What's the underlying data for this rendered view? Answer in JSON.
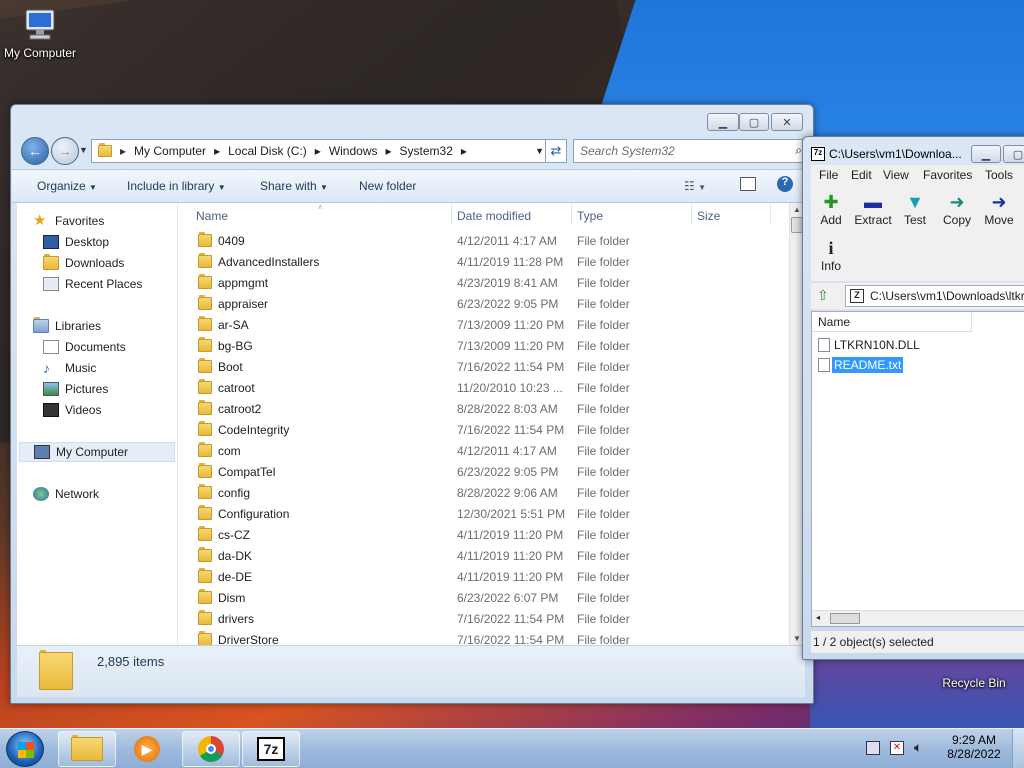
{
  "desktop": {
    "icons": [
      {
        "label": "My Computer"
      },
      {
        "label": "Recycle Bin"
      }
    ]
  },
  "explorer": {
    "breadcrumb": [
      "My Computer",
      "Local Disk (C:)",
      "Windows",
      "System32"
    ],
    "search_placeholder": "Search System32",
    "toolbar": {
      "organize": "Organize",
      "include_in_library": "Include in library",
      "share_with": "Share with",
      "new_folder": "New folder"
    },
    "nav": {
      "favorites": "Favorites",
      "desktop": "Desktop",
      "downloads": "Downloads",
      "recent_places": "Recent Places",
      "libraries": "Libraries",
      "documents": "Documents",
      "music": "Music",
      "pictures": "Pictures",
      "videos": "Videos",
      "my_computer": "My Computer",
      "network": "Network"
    },
    "columns": {
      "name": "Name",
      "date_modified": "Date modified",
      "type": "Type",
      "size": "Size"
    },
    "rows": [
      {
        "name": "0409",
        "date": "4/12/2011 4:17 AM",
        "type": "File folder"
      },
      {
        "name": "AdvancedInstallers",
        "date": "4/11/2019 11:28 PM",
        "type": "File folder"
      },
      {
        "name": "appmgmt",
        "date": "4/23/2019 8:41 AM",
        "type": "File folder"
      },
      {
        "name": "appraiser",
        "date": "6/23/2022 9:05 PM",
        "type": "File folder"
      },
      {
        "name": "ar-SA",
        "date": "7/13/2009 11:20 PM",
        "type": "File folder"
      },
      {
        "name": "bg-BG",
        "date": "7/13/2009 11:20 PM",
        "type": "File folder"
      },
      {
        "name": "Boot",
        "date": "7/16/2022 11:54 PM",
        "type": "File folder"
      },
      {
        "name": "catroot",
        "date": "11/20/2010 10:23 ...",
        "type": "File folder"
      },
      {
        "name": "catroot2",
        "date": "8/28/2022 8:03 AM",
        "type": "File folder"
      },
      {
        "name": "CodeIntegrity",
        "date": "7/16/2022 11:54 PM",
        "type": "File folder"
      },
      {
        "name": "com",
        "date": "4/12/2011 4:17 AM",
        "type": "File folder"
      },
      {
        "name": "CompatTel",
        "date": "6/23/2022 9:05 PM",
        "type": "File folder"
      },
      {
        "name": "config",
        "date": "8/28/2022 9:06 AM",
        "type": "File folder"
      },
      {
        "name": "Configuration",
        "date": "12/30/2021 5:51 PM",
        "type": "File folder"
      },
      {
        "name": "cs-CZ",
        "date": "4/11/2019 11:20 PM",
        "type": "File folder"
      },
      {
        "name": "da-DK",
        "date": "4/11/2019 11:20 PM",
        "type": "File folder"
      },
      {
        "name": "de-DE",
        "date": "4/11/2019 11:20 PM",
        "type": "File folder"
      },
      {
        "name": "Dism",
        "date": "6/23/2022 6:07 PM",
        "type": "File folder"
      },
      {
        "name": "drivers",
        "date": "7/16/2022 11:54 PM",
        "type": "File folder"
      },
      {
        "name": "DriverStore",
        "date": "7/16/2022 11:54 PM",
        "type": "File folder"
      }
    ],
    "status": "2,895 items"
  },
  "sevenzip": {
    "title": "C:\\Users\\vm1\\Downloa...",
    "menu": [
      "File",
      "Edit",
      "View",
      "Favorites",
      "Tools"
    ],
    "tools": [
      "Add",
      "Extract",
      "Test",
      "Copy",
      "Move",
      "Info"
    ],
    "path": "C:\\Users\\vm1\\Downloads\\ltkrn",
    "column_name": "Name",
    "files": [
      "LTKRN10N.DLL",
      "README.txt"
    ],
    "status": "1 / 2 object(s) selected"
  },
  "taskbar": {
    "time": "9:29 AM",
    "date": "8/28/2022"
  }
}
